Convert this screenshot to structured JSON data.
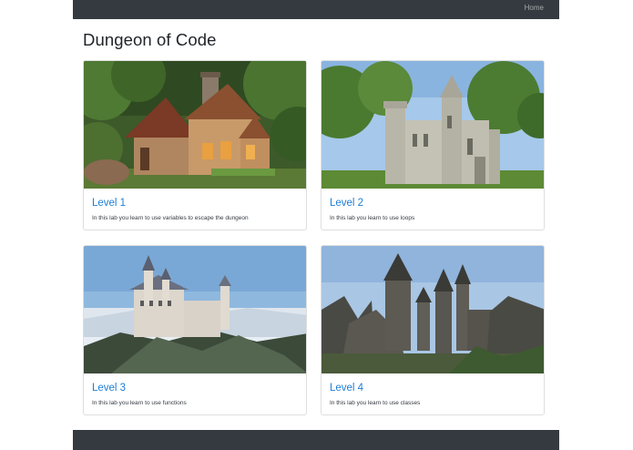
{
  "navbar": {
    "home_label": "Home"
  },
  "page": {
    "title": "Dungeon of Code"
  },
  "cards": [
    {
      "title": "Level 1",
      "text": "In this lab you learn to use variables to escape the dungeon",
      "image": "cottage-house-image"
    },
    {
      "title": "Level 2",
      "text": "In this lab you learn to use loops",
      "image": "concrete-castle-image"
    },
    {
      "title": "Level 3",
      "text": "In this lab you learn to use functions",
      "image": "neuschwanstein-castle-image"
    },
    {
      "title": "Level 4",
      "text": "In this lab you learn to use classes",
      "image": "hogwarts-castle-image"
    }
  ],
  "colors": {
    "navbar": "#343a40",
    "link": "#1c7ed6",
    "footer": "#343a40"
  }
}
